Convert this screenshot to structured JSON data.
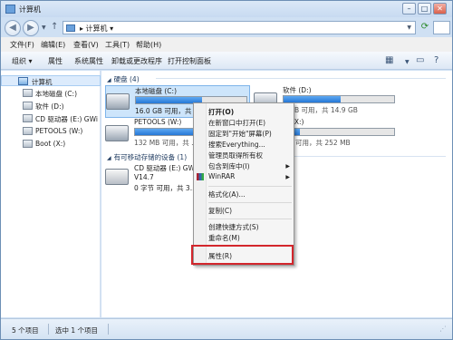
{
  "window": {
    "title": "计算机"
  },
  "address": {
    "path": "▸ 计算机 ▾"
  },
  "menu": [
    "文件(F)",
    "编辑(E)",
    "查看(V)",
    "工具(T)",
    "帮助(H)"
  ],
  "toolbar": {
    "organize": "组织 ▾",
    "properties": "属性",
    "system_properties": "系统属性",
    "uninstall": "卸载或更改程序",
    "control_panel": "打开控制面板"
  },
  "nav": {
    "root": "计算机",
    "items": [
      "本地磁盘 (C:)",
      "软件 (D:)",
      "CD 驱动器 (E:) GWi",
      "PETOOLS (W:)",
      "Boot (X:)"
    ]
  },
  "groups": {
    "hard_disks": "硬盘 (4)",
    "removable": "有可移动存储的设备 (1)"
  },
  "drives": {
    "c": {
      "name": "本地磁盘 (C:)",
      "info": "16.0 GB 可用，共 ...",
      "used_fraction": 0.6
    },
    "d": {
      "name": "软件 (D:)",
      "info": "7 GB 可用，共 14.9 GB",
      "used_fraction": 0.52
    },
    "w": {
      "name": "PETOOLS (W:)",
      "info": "132 MB 可用，共 ...",
      "used_fraction": 0.7
    },
    "x": {
      "name": "ot (X:)",
      "info": "MB 可用，共 252 MB",
      "used_fraction": 0.15
    },
    "e": {
      "name": "CD 驱动器 (E:) GW",
      "line2": "V14.7",
      "line3": "0 字节 可用，共 3..."
    }
  },
  "context_menu": {
    "open": "打开(O)",
    "open_new_window": "在新窗口中打开(E)",
    "pin_start": "固定到\"开始\"屏幕(P)",
    "search_everything": "搜索Everything...",
    "take_ownership": "管理员取得所有权",
    "include_library": "包含到库中(I)",
    "winrar": "WinRAR",
    "format": "格式化(A)...",
    "copy": "复制(C)",
    "create_shortcut": "创建快捷方式(S)",
    "rename": "重命名(M)",
    "properties": "属性(R)"
  },
  "status": {
    "count": "5 个项目",
    "selected": "选中 1 个项目"
  }
}
